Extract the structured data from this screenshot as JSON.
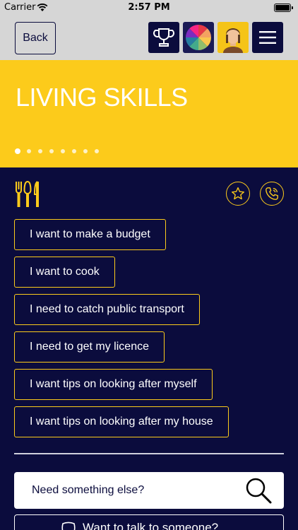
{
  "status_bar": {
    "carrier": "Carrier",
    "time": "2:57 PM"
  },
  "top_bar": {
    "back_label": "Back",
    "icons": [
      "trophy-icon",
      "color-wheel-icon",
      "avatar-icon",
      "hamburger-menu-icon"
    ]
  },
  "hero": {
    "title": "LIVING SKILLS",
    "page_count": 8,
    "active_page": 1,
    "background": "#fccb1b"
  },
  "section": {
    "icon": "cutlery-icon",
    "actions": [
      "star-icon",
      "phone-icon"
    ]
  },
  "options": [
    "I want to make a budget",
    "I want to cook",
    "I need to catch public transport",
    "I need to get my licence",
    "I want tips on looking after myself",
    "I want tips on looking after my house"
  ],
  "search": {
    "label": "Need something else?"
  },
  "talk": {
    "label": "Want to talk to someone?"
  },
  "colors": {
    "navy": "#0b0c3d",
    "yellow": "#fccb1b",
    "grey": "#d6d6d6"
  }
}
